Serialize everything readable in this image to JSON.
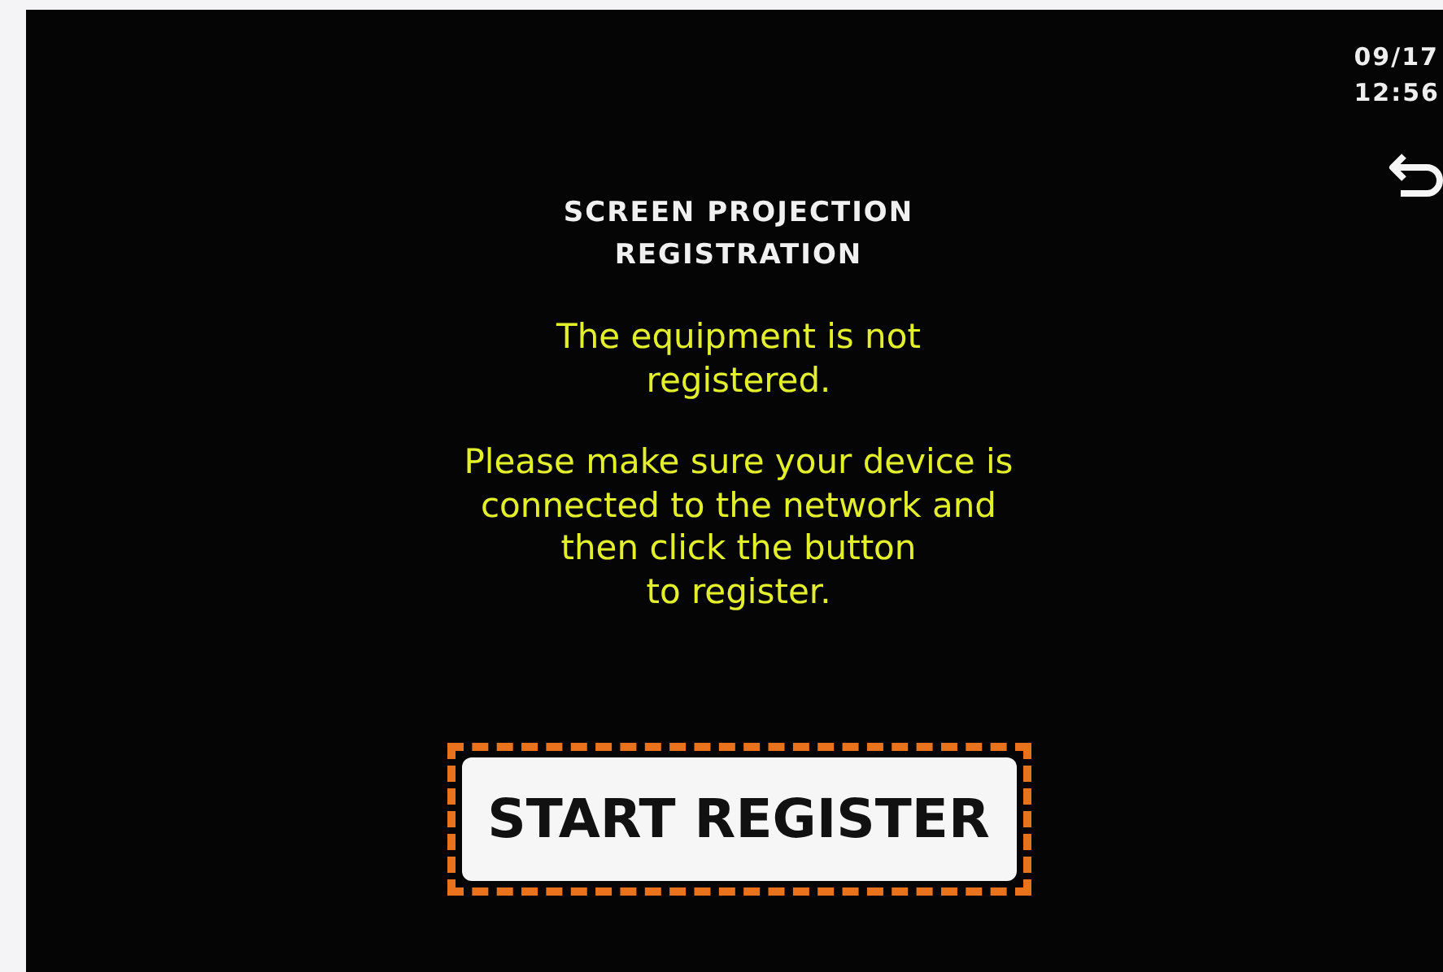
{
  "status": {
    "date": "09/17",
    "time": "12:56"
  },
  "title_lines": [
    "SCREEN PROJECTION",
    "REGISTRATION"
  ],
  "messages": [
    {
      "lines": [
        "The equipment is not",
        "registered."
      ]
    },
    {
      "lines": [
        "Please make sure your device is",
        "connected to the network and",
        "then click the button",
        "to register."
      ]
    }
  ],
  "button": {
    "label": "START REGISTER",
    "highlighted": true
  }
}
